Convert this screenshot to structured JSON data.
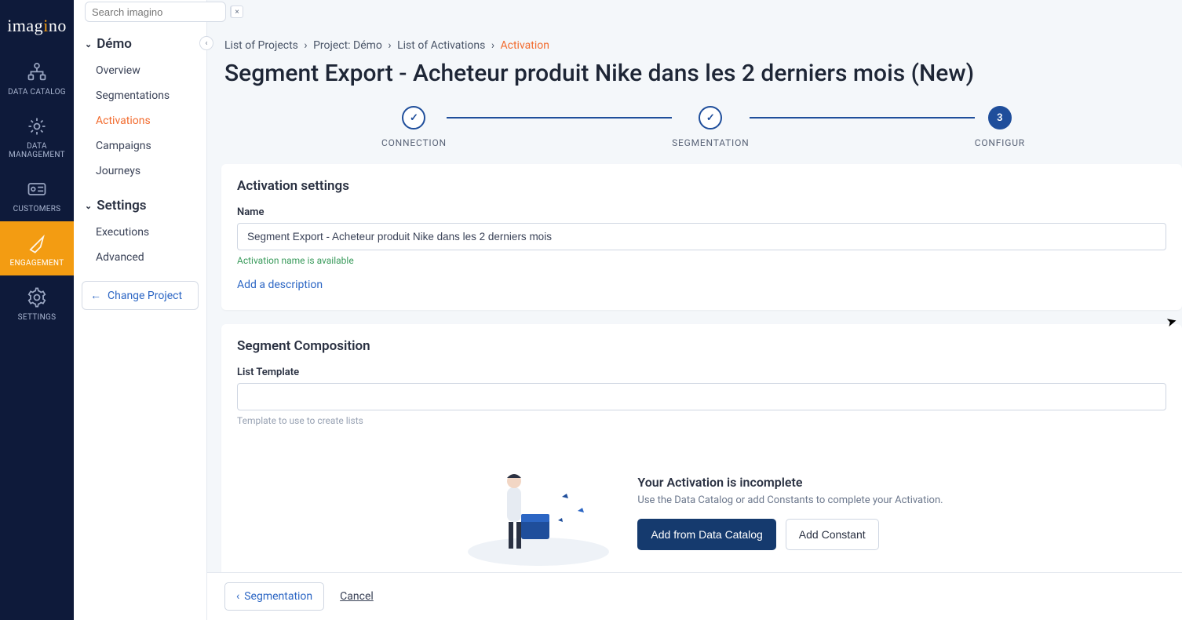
{
  "brand": "imagino",
  "search": {
    "placeholder": "Search imagino"
  },
  "rail": {
    "items": [
      {
        "id": "data-catalog",
        "label": "DATA CATALOG"
      },
      {
        "id": "data-management",
        "label": "DATA MANAGEMENT"
      },
      {
        "id": "customers",
        "label": "CUSTOMERS"
      },
      {
        "id": "engagement",
        "label": "ENGAGEMENT"
      },
      {
        "id": "settings",
        "label": "SETTINGS"
      }
    ]
  },
  "sidebar": {
    "group1_title": "Démo",
    "group1": [
      {
        "label": "Overview"
      },
      {
        "label": "Segmentations"
      },
      {
        "label": "Activations"
      },
      {
        "label": "Campaigns"
      },
      {
        "label": "Journeys"
      }
    ],
    "group2_title": "Settings",
    "group2": [
      {
        "label": "Executions"
      },
      {
        "label": "Advanced"
      }
    ],
    "change_project": "Change Project"
  },
  "breadcrumb": {
    "a": "List of Projects",
    "b": "Project: Démo",
    "c": "List of Activations",
    "d": "Activation"
  },
  "page_title": "Segment Export - Acheteur produit Nike dans les 2 derniers mois (New)",
  "stepper": {
    "s1": "CONNECTION",
    "s2": "SEGMENTATION",
    "s3": "CONFIGUR",
    "s3_num": "3"
  },
  "activation": {
    "heading": "Activation settings",
    "name_label": "Name",
    "name_value": "Segment Export - Acheteur produit Nike dans les 2 derniers mois",
    "name_helper": "Activation name is available",
    "add_desc": "Add a description"
  },
  "segment": {
    "heading": "Segment Composition",
    "list_label": "List Template",
    "list_value": "",
    "list_helper": "Template to use to create lists"
  },
  "empty": {
    "title": "Your Activation is incomplete",
    "sub": "Use the Data Catalog or add Constants to complete your Activation.",
    "btn_catalog": "Add from Data Catalog",
    "btn_constant": "Add Constant"
  },
  "footer": {
    "back": "Segmentation",
    "cancel": "Cancel"
  }
}
